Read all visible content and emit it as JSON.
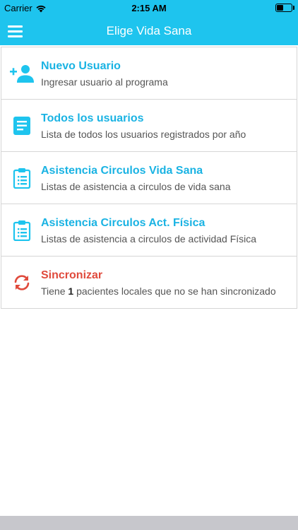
{
  "status_bar": {
    "carrier": "Carrier",
    "time": "2:15 AM",
    "battery_level": 0.45
  },
  "nav": {
    "title": "Elige Vida Sana"
  },
  "colors": {
    "accent": "#1ec4ee",
    "title_blue": "#1ab3e3",
    "alert_red": "#e04a3c"
  },
  "menu": [
    {
      "icon": "add-user-icon",
      "title": "Nuevo Usuario",
      "subtitle": "Ingresar usuario al programa"
    },
    {
      "icon": "document-list-icon",
      "title": "Todos los usuarios",
      "subtitle": "Lista de todos los usuarios registrados por año"
    },
    {
      "icon": "clipboard-icon",
      "title": "Asistencia Circulos Vida Sana",
      "subtitle": "Listas de asistencia a circulos de vida sana"
    },
    {
      "icon": "clipboard-icon",
      "title": "Asistencia Circulos Act. Física",
      "subtitle": "Listas de asistencia a circulos de actividad Física"
    },
    {
      "icon": "sync-icon",
      "title": "Sincronizar",
      "subtitle_prefix": "Tiene",
      "subtitle_count": "1",
      "subtitle_suffix": "pacientes locales que no se han sincronizado"
    }
  ]
}
